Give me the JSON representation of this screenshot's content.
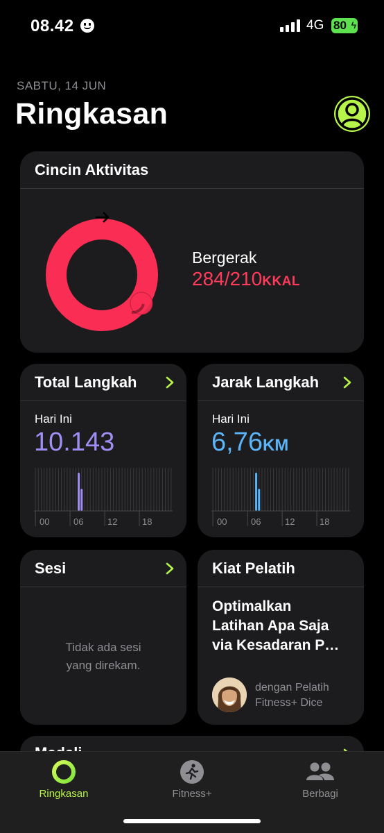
{
  "status_bar": {
    "time": "08.42",
    "network": "4G",
    "battery": "80"
  },
  "header": {
    "date": "SABTU, 14 JUN",
    "title": "Ringkasan"
  },
  "activity_ring": {
    "title": "Cincin Aktivitas",
    "move_label": "Bergerak",
    "move_value": "284/210",
    "move_unit": "KKAL",
    "move_progress": 1.352,
    "ring_color": "#fa2d55"
  },
  "steps": {
    "title": "Total Langkah",
    "today_label": "Hari Ini",
    "value": "10.143",
    "accent": "#a18ef2",
    "ticks": [
      "00",
      "06",
      "12",
      "18"
    ],
    "hourly_bars": [
      0,
      0,
      0,
      0,
      0,
      0,
      0,
      0,
      0,
      0,
      0,
      0,
      0,
      0,
      0,
      0.95,
      0.55,
      0,
      0,
      0,
      0,
      0,
      0,
      0,
      0,
      0,
      0,
      0,
      0,
      0,
      0,
      0,
      0,
      0,
      0,
      0,
      0,
      0,
      0,
      0,
      0,
      0,
      0,
      0,
      0,
      0,
      0,
      0
    ]
  },
  "distance": {
    "title": "Jarak Langkah",
    "today_label": "Hari Ini",
    "value": "6,76",
    "unit": "KM",
    "accent": "#5ab4f7",
    "ticks": [
      "00",
      "06",
      "12",
      "18"
    ],
    "hourly_bars": [
      0,
      0,
      0,
      0,
      0,
      0,
      0,
      0,
      0,
      0,
      0,
      0,
      0,
      0,
      0,
      0.95,
      0.55,
      0,
      0,
      0,
      0,
      0,
      0,
      0,
      0,
      0,
      0,
      0,
      0,
      0,
      0,
      0,
      0,
      0,
      0,
      0,
      0,
      0,
      0,
      0,
      0,
      0,
      0,
      0,
      0,
      0,
      0,
      0
    ]
  },
  "sessions": {
    "title": "Sesi",
    "empty_text": "Tidak ada sesi\nyang direkam."
  },
  "coach_tip": {
    "title": "Kiat Pelatih",
    "headline": "Optimalkan\nLatihan Apa Saja\nvia Kesadaran P…",
    "byline": "dengan Pelatih\nFitness+ Dice"
  },
  "next_card": {
    "title": "Medali"
  },
  "tab_bar": {
    "tabs": [
      {
        "label": "Ringkasan",
        "icon": "activity-ring-icon",
        "active": true
      },
      {
        "label": "Fitness+",
        "icon": "fitness-runner-icon",
        "active": false
      },
      {
        "label": "Berbagi",
        "icon": "people-icon",
        "active": false
      }
    ],
    "active_color": "#b7f44a"
  }
}
